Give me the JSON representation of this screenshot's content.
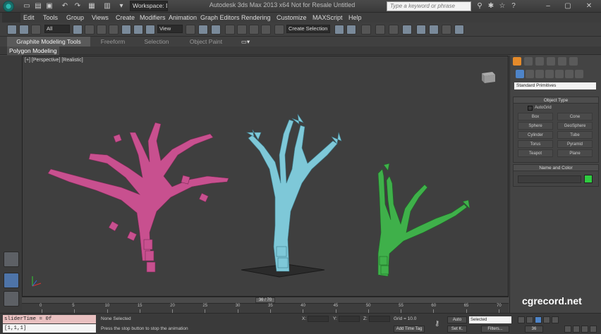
{
  "title_bar": {
    "workspace": "Workspace: Default",
    "window_title": "Autodesk 3ds Max 2013 x64    Not for Resale    Untitled",
    "search_placeholder": "Type a keyword or phrase"
  },
  "menus": [
    "Edit",
    "Tools",
    "Group",
    "Views",
    "Create",
    "Modifiers",
    "Animation",
    "Graph Editors",
    "Rendering",
    "Customize",
    "MAXScript",
    "Help"
  ],
  "toolbar": {
    "selection_filter": "All",
    "ref_coord": "View",
    "named_selection": "Create Selection Se"
  },
  "ribbon": {
    "tabs": [
      "Graphite Modeling Tools",
      "Freeform",
      "Selection",
      "Object Paint"
    ],
    "active_panel": "Polygon Modeling"
  },
  "viewport": {
    "label": "[+] [Perspective] [Realistic]",
    "trees": [
      {
        "color": "#c8508f"
      },
      {
        "color": "#7ec8d8"
      },
      {
        "color": "#3fb04a"
      }
    ]
  },
  "command_panel": {
    "category": "Standard Primitives",
    "object_type_title": "Object Type",
    "autogrid": "AutoGrid",
    "buttons": [
      "Box",
      "Cone",
      "Sphere",
      "GeoSphere",
      "Cylinder",
      "Tube",
      "Torus",
      "Pyramid",
      "Teapot",
      "Plane"
    ],
    "name_color_title": "Name and Color",
    "object_color": "#2ecc40"
  },
  "timeline": {
    "current": "36 / 70",
    "ticks": [
      "0",
      "5",
      "10",
      "15",
      "20",
      "25",
      "30",
      "35",
      "40",
      "45",
      "50",
      "55",
      "60",
      "65",
      "70"
    ]
  },
  "status": {
    "listener_top": "sliderTime = 0f",
    "listener_bottom": "[1,1,1]",
    "selection": "None Selected",
    "prompt": "Press the stop button to stop the animation",
    "x_label": "X:",
    "y_label": "Y:",
    "z_label": "Z:",
    "grid": "Grid = 10.0",
    "auto": "Auto",
    "set_key": "Set K.",
    "selected": "Selected",
    "filters": "Filters...",
    "add_time_tag": "Add Time Tag",
    "frame": "36"
  },
  "watermark": "cgrecord.net"
}
